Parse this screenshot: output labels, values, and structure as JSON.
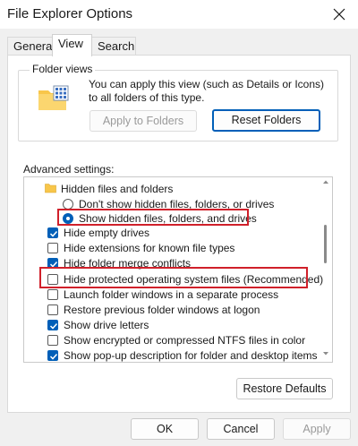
{
  "window": {
    "title": "File Explorer Options",
    "close_icon": "close-icon"
  },
  "tabs": [
    {
      "label": "General",
      "active": false
    },
    {
      "label": "View",
      "active": true
    },
    {
      "label": "Search",
      "active": false
    }
  ],
  "folder_views": {
    "title": "Folder views",
    "description": "You can apply this view (such as Details or Icons) to all folders of this type.",
    "icon": "folder-views-icon",
    "apply_label": "Apply to Folders",
    "reset_label": "Reset Folders"
  },
  "advanced": {
    "label": "Advanced settings:",
    "items": [
      {
        "type": "folder",
        "label": "Hidden files and folders"
      },
      {
        "type": "radio",
        "label": "Don't show hidden files, folders, or drives",
        "checked": false
      },
      {
        "type": "radio",
        "label": "Show hidden files, folders, and drives",
        "checked": true
      },
      {
        "type": "checkbox",
        "label": "Hide empty drives",
        "checked": true
      },
      {
        "type": "checkbox",
        "label": "Hide extensions for known file types",
        "checked": false
      },
      {
        "type": "checkbox",
        "label": "Hide folder merge conflicts",
        "checked": true
      },
      {
        "type": "checkbox",
        "label": "Hide protected operating system files (Recommended)",
        "checked": false
      },
      {
        "type": "checkbox",
        "label": "Launch folder windows in a separate process",
        "checked": false
      },
      {
        "type": "checkbox",
        "label": "Restore previous folder windows at logon",
        "checked": false
      },
      {
        "type": "checkbox",
        "label": "Show drive letters",
        "checked": true
      },
      {
        "type": "checkbox",
        "label": "Show encrypted or compressed NTFS files in color",
        "checked": false
      },
      {
        "type": "checkbox",
        "label": "Show pop-up description for folder and desktop items",
        "checked": true
      }
    ],
    "restore_label": "Restore Defaults"
  },
  "footer": {
    "ok": "OK",
    "cancel": "Cancel",
    "apply": "Apply"
  },
  "colors": {
    "accent": "#005fb8",
    "highlight": "#d0202a"
  }
}
